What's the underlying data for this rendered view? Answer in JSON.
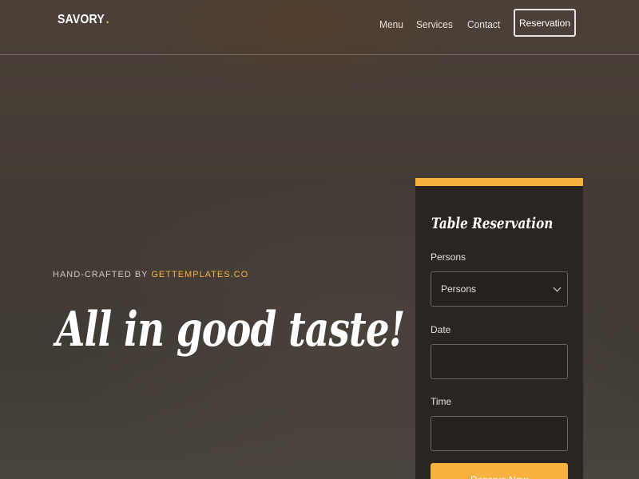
{
  "header": {
    "logo": "SAVORY",
    "logo_dot": ".",
    "nav": [
      "Menu",
      "Services",
      "Contact"
    ],
    "reservation_button": "Reservation"
  },
  "hero": {
    "tagline_prefix": "HAND-CRAFTED BY ",
    "tagline_link": "GETTEMPLATES.CO",
    "headline": "All in good taste!"
  },
  "reservation_form": {
    "title": "Table Reservation",
    "persons_label": "Persons",
    "persons_value": "Persons",
    "date_label": "Date",
    "time_label": "Time",
    "submit_label": "Reserve Now"
  },
  "colors": {
    "accent": "#f6b13f",
    "card_bg": "#2a2521"
  }
}
